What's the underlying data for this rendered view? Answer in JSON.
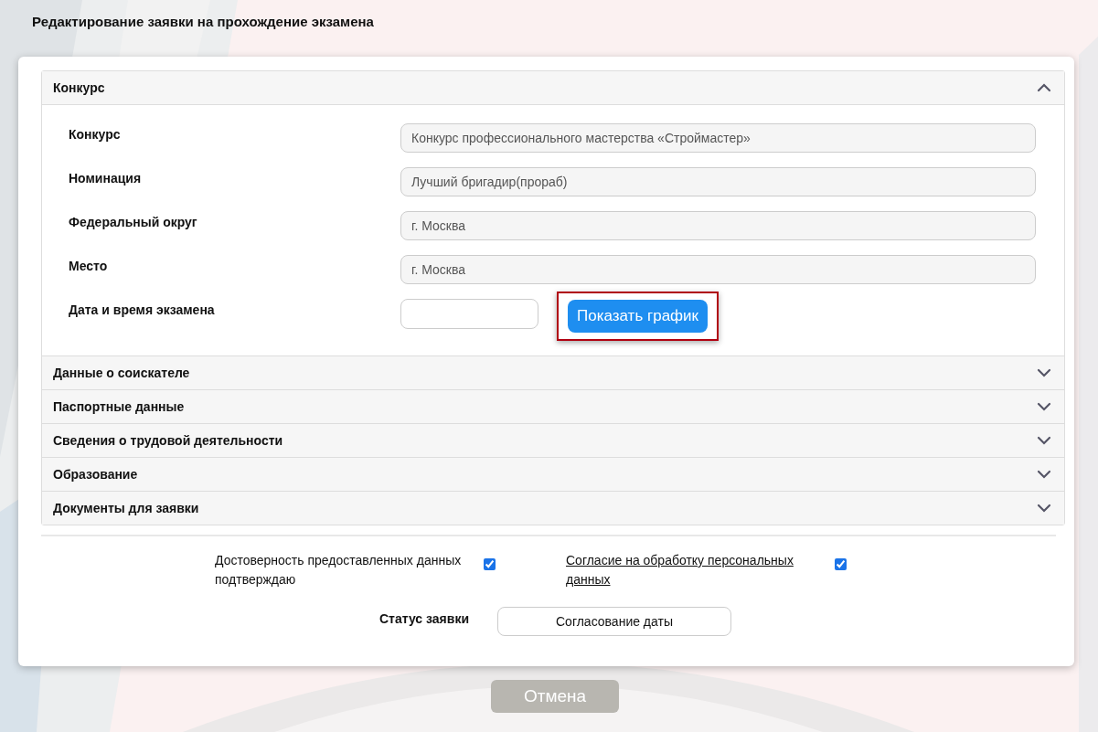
{
  "page_title": "Редактирование заявки на прохождение экзамена",
  "sections": [
    {
      "title": "Конкурс",
      "expanded": true,
      "fields": [
        {
          "kind": "text",
          "label": "Конкурс",
          "value": "Конкурс профессионального мастерства «Строймастер»"
        },
        {
          "kind": "text",
          "label": "Номинация",
          "value": "Лучший бригадир(прораб)"
        },
        {
          "kind": "text",
          "label": "Федеральный округ",
          "value": "г. Москва"
        },
        {
          "kind": "text",
          "label": "Место",
          "value": "г. Москва"
        },
        {
          "kind": "date",
          "label": "Дата и время экзамена",
          "button": {
            "label": "Показать график",
            "highlighted": true
          }
        }
      ]
    },
    {
      "title": "Данные о соискателе",
      "expanded": false
    },
    {
      "title": "Паспортные данные",
      "expanded": false
    },
    {
      "title": "Сведения о трудовой деятельности",
      "expanded": false
    },
    {
      "title": "Образование",
      "expanded": false
    },
    {
      "title": "Документы для заявки",
      "expanded": false
    }
  ],
  "agreements": [
    {
      "kind": "text",
      "text": "Достоверность предоставленных данных подтверждаю",
      "checked": true
    },
    {
      "kind": "link",
      "text": "Согласие на обработку персональных данных",
      "checked": true
    }
  ],
  "status": {
    "label": "Статус заявки",
    "value": "Согласование даты"
  },
  "cancel_button": "Отмена"
}
